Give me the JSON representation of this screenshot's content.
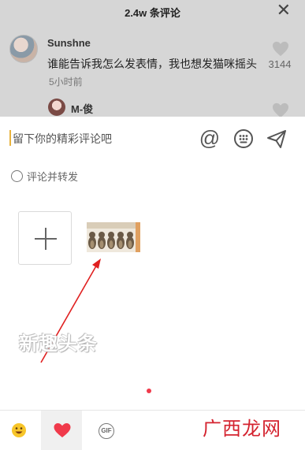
{
  "header": {
    "title": "2.4w 条评论",
    "close_symbol": "✕"
  },
  "comment": {
    "username": "Sunshne",
    "text": "谁能告诉我怎么发表情，我也想发猫咪摇头",
    "time": "5小时前",
    "like_count": "3144"
  },
  "reply": {
    "username": "M-俊"
  },
  "composer": {
    "placeholder": "留下你的精彩评论吧",
    "at_symbol": "@",
    "repost_label": "评论并转发"
  },
  "watermark": "新趣头条",
  "tabs": [
    {
      "icon": "smile-emoji-icon"
    },
    {
      "icon": "heart-icon",
      "selected": true
    },
    {
      "icon": "gif-icon",
      "label": "GIF"
    }
  ],
  "brand": "广西龙网",
  "colors": {
    "accent": "#f03a4b",
    "caret": "#e8b23c",
    "arrow": "#e02020",
    "brand": "#d4232f"
  }
}
